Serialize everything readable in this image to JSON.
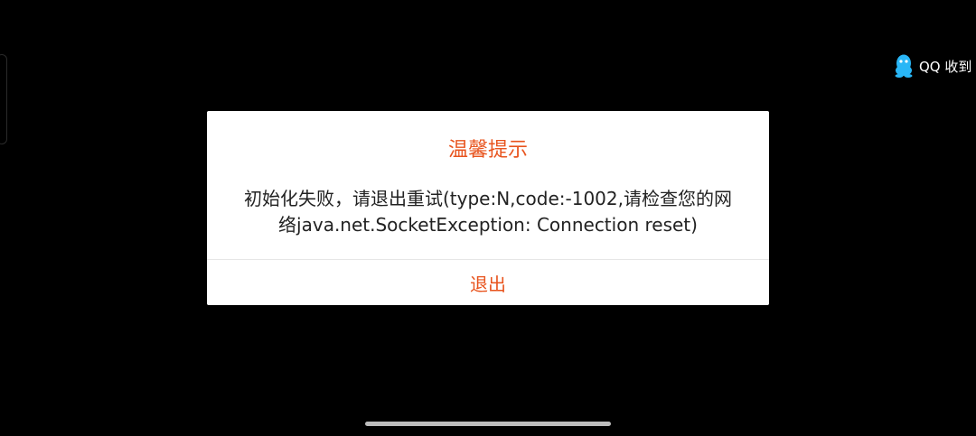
{
  "notification": {
    "icon": "qq-penguin-icon",
    "text": "QQ 收到"
  },
  "dialog": {
    "title": "温馨提示",
    "message_line1": "初始化失败，请退出重试(type:N,code:-1002,请检查您的网",
    "message_line2": "络java.net.SocketException: Connection reset)",
    "exit_label": "退出",
    "accent_color": "#e8541e"
  }
}
